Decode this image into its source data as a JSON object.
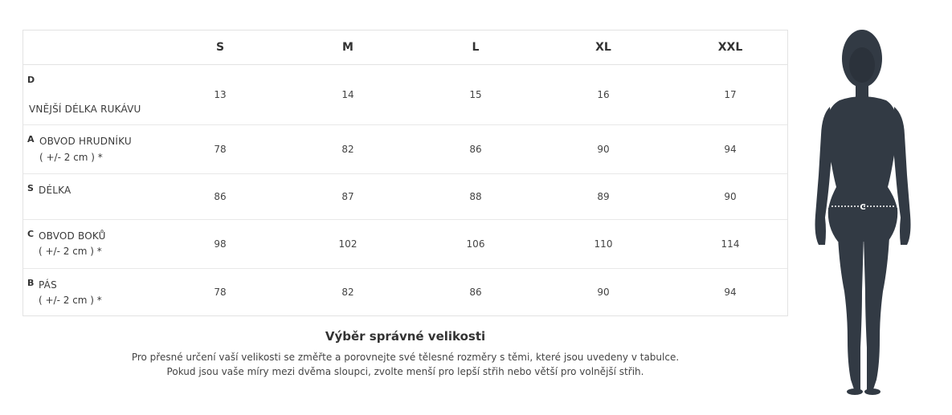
{
  "sizes": [
    "S",
    "M",
    "L",
    "XL",
    "XXL"
  ],
  "rows": [
    {
      "letter": "D",
      "name": "VNĚJŠÍ DÉLKA RUKÁVU",
      "note": "",
      "values": [
        "13",
        "14",
        "15",
        "16",
        "17"
      ]
    },
    {
      "letter": "A",
      "name": "OBVOD HRUDNÍKU",
      "note": "( +/- 2 cm ) *",
      "values": [
        "78",
        "82",
        "86",
        "90",
        "94"
      ]
    },
    {
      "letter": "S",
      "name": "DÉLKA",
      "note": "",
      "values": [
        "86",
        "87",
        "88",
        "89",
        "90"
      ]
    },
    {
      "letter": "C",
      "name": "OBVOD BOKŮ",
      "note": "( +/- 2 cm ) *",
      "values": [
        "98",
        "102",
        "106",
        "110",
        "114"
      ]
    },
    {
      "letter": "B",
      "name": "PÁS",
      "note": "( +/- 2 cm ) *",
      "values": [
        "78",
        "82",
        "86",
        "90",
        "94"
      ]
    }
  ],
  "guide": {
    "title": "Výběr správné velikosti",
    "line1": "Pro přesné určení vaší velikosti se změřte a porovnejte své tělesné rozměry s těmi, které jsou uvedeny v tabulce.",
    "line2": "Pokud jsou vaše míry mezi dvěma sloupci, zvolte menší pro lepší střih nebo větší pro volnější střih."
  },
  "figure": {
    "marker": "C",
    "fill_color": "#323a44"
  }
}
